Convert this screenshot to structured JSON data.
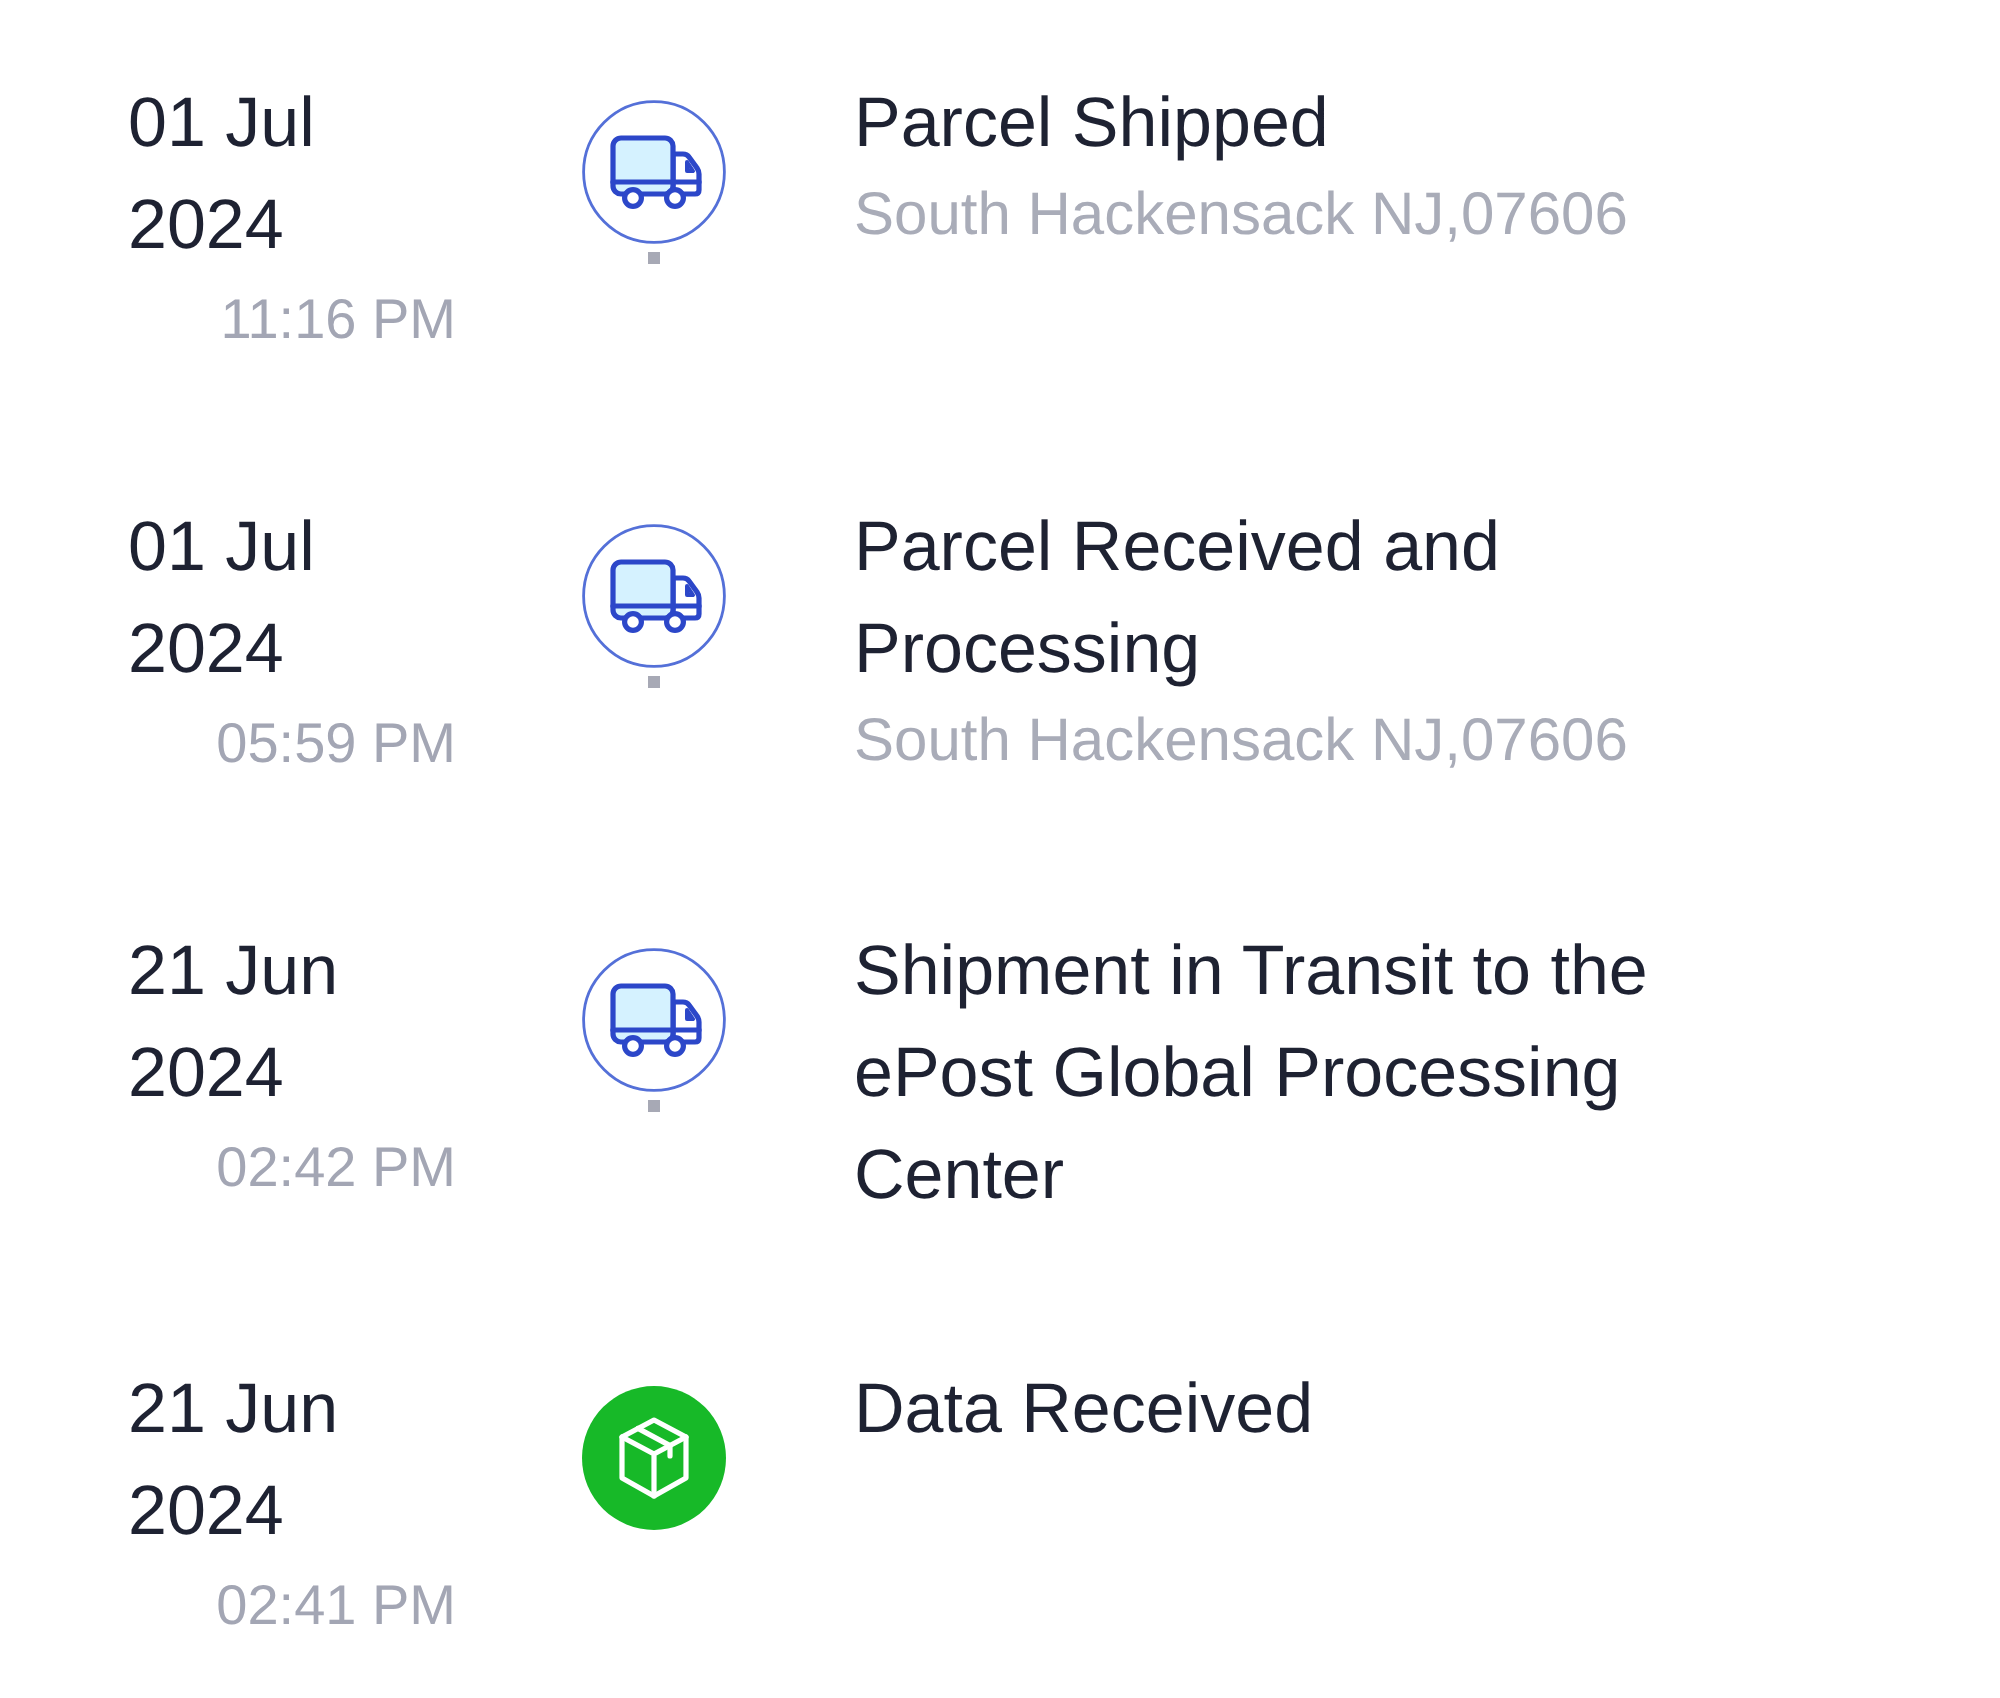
{
  "events": [
    {
      "date": "01 Jul 2024",
      "time": "11:16 PM",
      "kind": "truck",
      "title": "Parcel Shipped",
      "location": "South Hackensack NJ,07606"
    },
    {
      "date": "01 Jul 2024",
      "time": "05:59 PM",
      "kind": "truck",
      "title": "Parcel Received and Processing",
      "location": "South Hackensack NJ,07606"
    },
    {
      "date": "21 Jun 2024",
      "time": "02:42 PM",
      "kind": "truck",
      "title": "Shipment in Transit to the ePost Global Processing Center"
    },
    {
      "date": "21 Jun 2024",
      "time": "02:41 PM",
      "kind": "box",
      "title": "Data Received"
    }
  ]
}
